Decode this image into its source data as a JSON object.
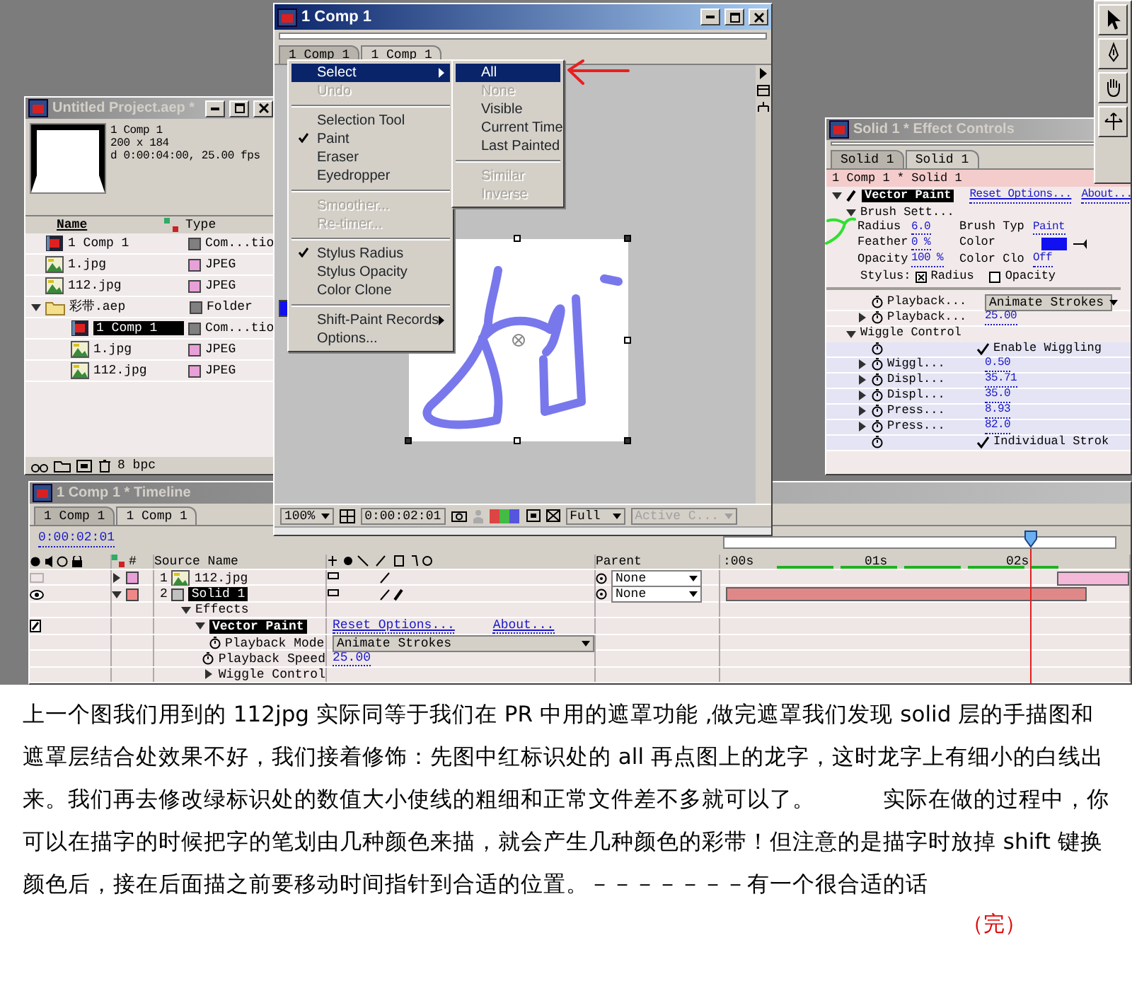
{
  "project": {
    "title": "Untitled Project.aep *",
    "info": [
      "1 Comp 1",
      "200 x 184",
      "d 0:00:04:00, 25.00 fps"
    ],
    "columns": [
      "Name",
      "Type"
    ],
    "items": [
      {
        "name": "1 Comp 1",
        "kind": "comp",
        "type": "Com...tio",
        "color": "#808080",
        "selected": false
      },
      {
        "name": "1.jpg",
        "kind": "footage",
        "type": "JPEG",
        "color": "#e8a0d8",
        "selected": false
      },
      {
        "name": "112.jpg",
        "kind": "footage",
        "type": "JPEG",
        "color": "#e8a0d8",
        "selected": false
      },
      {
        "name": "彩带.aep",
        "kind": "folder",
        "type": "Folder",
        "color": "#808080",
        "selected": false,
        "expanded": true,
        "children": [
          {
            "name": "1 Comp 1",
            "kind": "comp",
            "type": "Com...tio",
            "color": "#808080",
            "selected": true
          },
          {
            "name": "1.jpg",
            "kind": "footage",
            "type": "JPEG",
            "color": "#e8a0d8",
            "selected": false
          },
          {
            "name": "112.jpg",
            "kind": "footage",
            "type": "JPEG",
            "color": "#e8a0d8",
            "selected": false
          }
        ]
      }
    ],
    "footer": "8 bpc"
  },
  "comp": {
    "title": "1 Comp 1",
    "tabs": [
      {
        "label": "1 Comp 1",
        "selected": false
      },
      {
        "label": "1 Comp 1",
        "selected": true
      }
    ],
    "menu": [
      {
        "kind": "item",
        "label": "Select",
        "submenu": true,
        "selected": true,
        "checked": false,
        "disabled": false
      },
      {
        "kind": "item",
        "label": "Undo",
        "submenu": false,
        "selected": false,
        "checked": false,
        "disabled": true
      },
      {
        "kind": "separator"
      },
      {
        "kind": "item",
        "label": "Selection Tool",
        "submenu": false,
        "selected": false,
        "checked": false,
        "disabled": false
      },
      {
        "kind": "item",
        "label": "Paint",
        "submenu": false,
        "selected": false,
        "checked": true,
        "disabled": false
      },
      {
        "kind": "item",
        "label": "Eraser",
        "submenu": false,
        "selected": false,
        "checked": false,
        "disabled": false
      },
      {
        "kind": "item",
        "label": "Eyedropper",
        "submenu": false,
        "selected": false,
        "checked": false,
        "disabled": false
      },
      {
        "kind": "separator"
      },
      {
        "kind": "item",
        "label": "Smoother...",
        "submenu": false,
        "selected": false,
        "checked": false,
        "disabled": true
      },
      {
        "kind": "item",
        "label": "Re-timer...",
        "submenu": false,
        "selected": false,
        "checked": false,
        "disabled": true
      },
      {
        "kind": "separator"
      },
      {
        "kind": "item",
        "label": "Stylus Radius",
        "submenu": false,
        "selected": false,
        "checked": true,
        "disabled": false
      },
      {
        "kind": "item",
        "label": "Stylus Opacity",
        "submenu": false,
        "selected": false,
        "checked": false,
        "disabled": false
      },
      {
        "kind": "item",
        "label": "Color Clone",
        "submenu": false,
        "selected": false,
        "checked": false,
        "disabled": false
      },
      {
        "kind": "separator"
      },
      {
        "kind": "item",
        "label": "Shift-Paint Records",
        "submenu": true,
        "selected": false,
        "checked": false,
        "disabled": false
      },
      {
        "kind": "item",
        "label": "Options...",
        "submenu": false,
        "selected": false,
        "checked": false,
        "disabled": false
      }
    ],
    "submenu": [
      {
        "kind": "item",
        "label": "All",
        "selected": true,
        "disabled": false
      },
      {
        "kind": "item",
        "label": "None",
        "selected": false,
        "disabled": true
      },
      {
        "kind": "item",
        "label": "Visible",
        "selected": false,
        "disabled": false
      },
      {
        "kind": "item",
        "label": "Current Time",
        "selected": false,
        "disabled": false
      },
      {
        "kind": "item",
        "label": "Last Painted",
        "selected": false,
        "disabled": false
      },
      {
        "kind": "separator"
      },
      {
        "kind": "item",
        "label": "Similar",
        "selected": false,
        "disabled": true
      },
      {
        "kind": "item",
        "label": "Inverse",
        "selected": false,
        "disabled": true
      }
    ],
    "zoom": "100%",
    "time": "0:00:02:01",
    "resolution": "Full",
    "view": "Active C..."
  },
  "effects": {
    "title": "Solid 1 * Effect Controls",
    "tabs": [
      {
        "label": "Solid 1",
        "selected": false
      },
      {
        "label": "Solid 1",
        "selected": true
      }
    ],
    "breadcrumb": "1 Comp 1 * Solid 1",
    "effect": {
      "name": "Vector Paint",
      "reset": "Reset Options...",
      "about": "About..."
    },
    "brush": {
      "label": "Brush Sett...",
      "expanded": true,
      "fields": [
        {
          "kind": "value",
          "label": "Radius",
          "value": "6.0"
        },
        {
          "kind": "value",
          "label": "Brush Typ",
          "value": "Paint"
        },
        {
          "kind": "value",
          "label": "Feather",
          "value": "0 %"
        },
        {
          "kind": "color",
          "label": "Color",
          "color": "#1010f0"
        },
        {
          "kind": "value",
          "label": "Opacity",
          "value": "100 %"
        },
        {
          "kind": "value",
          "label": "Color Clo",
          "value": "Off"
        }
      ],
      "stylus_label": "Stylus:",
      "stylus": [
        {
          "label": "Radius",
          "checked": true
        },
        {
          "label": "Opacity",
          "checked": false
        }
      ]
    },
    "params": [
      {
        "kind": "dropdown",
        "label": "Playback...",
        "value": "Animate Strokes",
        "expandable": false
      },
      {
        "kind": "value",
        "label": "Playback...",
        "value": "25.00",
        "expandable": true
      }
    ],
    "wiggle": {
      "label": "Wiggle Control",
      "expanded": true,
      "params": [
        {
          "kind": "checkbox",
          "label": "Enable Wiggling",
          "checked": true,
          "expandable": false
        },
        {
          "kind": "value",
          "label": "Wiggl...",
          "value": "0.50",
          "expandable": true
        },
        {
          "kind": "value",
          "label": "Displ...",
          "value": "35.71",
          "expandable": true
        },
        {
          "kind": "value",
          "label": "Displ...",
          "value": "35.0",
          "expandable": true
        },
        {
          "kind": "value",
          "label": "Press...",
          "value": "8.93",
          "expandable": true
        },
        {
          "kind": "value",
          "label": "Press...",
          "value": "82.0",
          "expandable": true
        },
        {
          "kind": "checkbox",
          "label": "Individual Strok",
          "checked": true,
          "expandable": false
        }
      ]
    }
  },
  "timeline": {
    "title": "1 Comp 1 * Timeline",
    "tabs": [
      {
        "label": "1 Comp 1",
        "selected": false
      },
      {
        "label": "1 Comp 1",
        "selected": true
      }
    ],
    "time": "0:00:02:01",
    "columns": [
      "#",
      "Source Name",
      "Parent"
    ],
    "ruler": [
      ":00s",
      "01s",
      "02s"
    ],
    "layers": [
      {
        "num": "1",
        "name": "112.jpg",
        "kind": "footage",
        "color": "#e8a0d8",
        "visible": false,
        "expanded": false,
        "selected": false,
        "parent": "None"
      },
      {
        "num": "2",
        "name": "Solid 1",
        "kind": "solid",
        "color": "#f08888",
        "visible": true,
        "expanded": true,
        "selected": true,
        "parent": "None"
      }
    ],
    "properties": [
      {
        "kind": "group",
        "label": "Effects",
        "expanded": true,
        "children": [
          {
            "kind": "effect",
            "label": "Vector Paint",
            "expanded": true,
            "reset": "Reset Options...",
            "about": "About...",
            "children": [
              {
                "kind": "dropdown",
                "label": "Playback Mode",
                "value": "Animate Strokes"
              },
              {
                "kind": "value",
                "label": "Playback Speed",
                "value": "25.00"
              },
              {
                "kind": "group",
                "label": "Wiggle Control",
                "expanded": false
              }
            ]
          }
        ]
      }
    ]
  },
  "article": {
    "paragraph": "上一个图我们用到的 112jpg 实际同等于我们在 PR 中用的遮罩功能 ,做完遮罩我们发现 solid 层的手描图和遮罩层结合处效果不好，我们接着修饰：先图中红标识处的 all 再点图上的龙字，这时龙字上有细小的白线出来。我们再去修改绿标识处的数值大小使线的粗细和正常文件差不多就可以了。　　　实际在做的过程中，你可以在描字的时候把字的笔划由几种颜色来描，就会产生几种颜色的彩带！但注意的是描字时放掉 shift 键换颜色后，接在后面描之前要移动时间指针到合适的位置。－－－－－－－有一个很合适的话",
    "end_mark": "（完）"
  }
}
